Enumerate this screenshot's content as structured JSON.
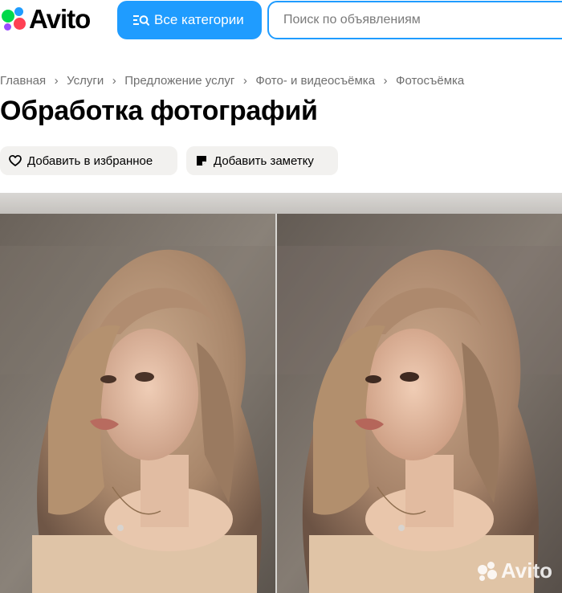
{
  "header": {
    "logo_text": "Avito",
    "categories_button": "Все категории",
    "search_placeholder": "Поиск по объявлениям"
  },
  "breadcrumb": [
    "Главная",
    "Услуги",
    "Предложение услуг",
    "Фото- и видеосъёмка",
    "Фотосъёмка"
  ],
  "title": "Обработка фотографий",
  "actions": {
    "favorite": "Добавить в избранное",
    "note": "Добавить заметку"
  },
  "gallery": {
    "watermark": "Avito"
  },
  "colors": {
    "accent": "#1f9cff",
    "button_bg": "#f2f1ef"
  }
}
